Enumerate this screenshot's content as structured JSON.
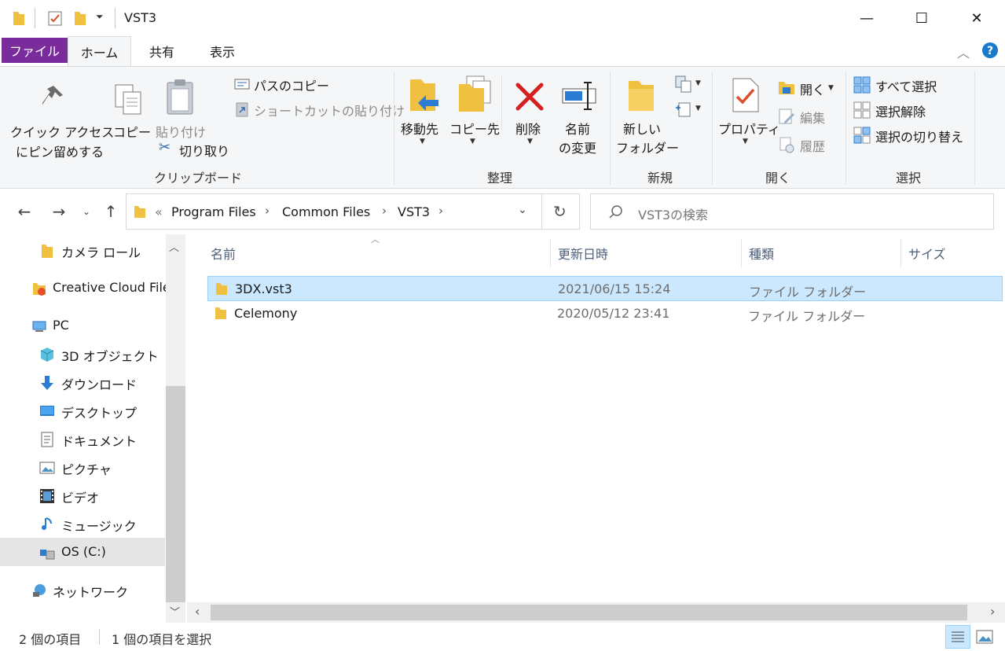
{
  "window": {
    "title": "VST3",
    "minimize_glyph": "—",
    "maximize_glyph": "☐",
    "close_glyph": "✕"
  },
  "ribbon_tabs": {
    "file": "ファイル",
    "home": "ホーム",
    "share": "共有",
    "view": "表示"
  },
  "clipboard": {
    "pin_line1": "クイック アクセス",
    "pin_line2": "にピン留めする",
    "copy": "コピー",
    "paste": "貼り付け",
    "copy_path": "パスのコピー",
    "paste_shortcut": "ショートカットの貼り付け",
    "cut": "切り取り",
    "group": "クリップボード"
  },
  "organize": {
    "move_to": "移動先",
    "copy_to": "コピー先",
    "delete": "削除",
    "rename_line1": "名前",
    "rename_line2": "の変更",
    "group": "整理"
  },
  "new": {
    "new_folder_line1": "新しい",
    "new_folder_line2": "フォルダー",
    "group": "新規"
  },
  "open": {
    "properties": "プロパティ",
    "open": "開く",
    "edit": "編集",
    "history": "履歴",
    "group": "開く"
  },
  "select": {
    "select_all": "すべて選択",
    "select_none": "選択解除",
    "invert_selection": "選択の切り替え",
    "group": "選択"
  },
  "address": {
    "overflow": "«",
    "crumbs": [
      "Program Files",
      "Common Files",
      "VST3"
    ],
    "search_placeholder": "VST3の検索"
  },
  "nav_pane": {
    "items": [
      "カメラ ロール",
      "Creative Cloud File",
      "PC",
      "3D オブジェクト",
      "ダウンロード",
      "デスクトップ",
      "ドキュメント",
      "ピクチャ",
      "ビデオ",
      "ミュージック",
      "OS (C:)",
      "ネットワーク"
    ]
  },
  "file_list": {
    "columns": [
      "名前",
      "更新日時",
      "種類",
      "サイズ"
    ],
    "rows": [
      {
        "name": "3DX.vst3",
        "modified": "2021/06/15 15:24",
        "type": "ファイル フォルダー",
        "size": ""
      },
      {
        "name": "Celemony",
        "modified": "2020/05/12 23:41",
        "type": "ファイル フォルダー",
        "size": ""
      }
    ]
  },
  "status": {
    "item_count": "2 個の項目",
    "selected_count": "1 個の項目を選択"
  },
  "colors": {
    "file_tab": "#7a2c9c",
    "selection": "#cce8ff",
    "folder": "#f0c040",
    "delete_red": "#d42020"
  }
}
